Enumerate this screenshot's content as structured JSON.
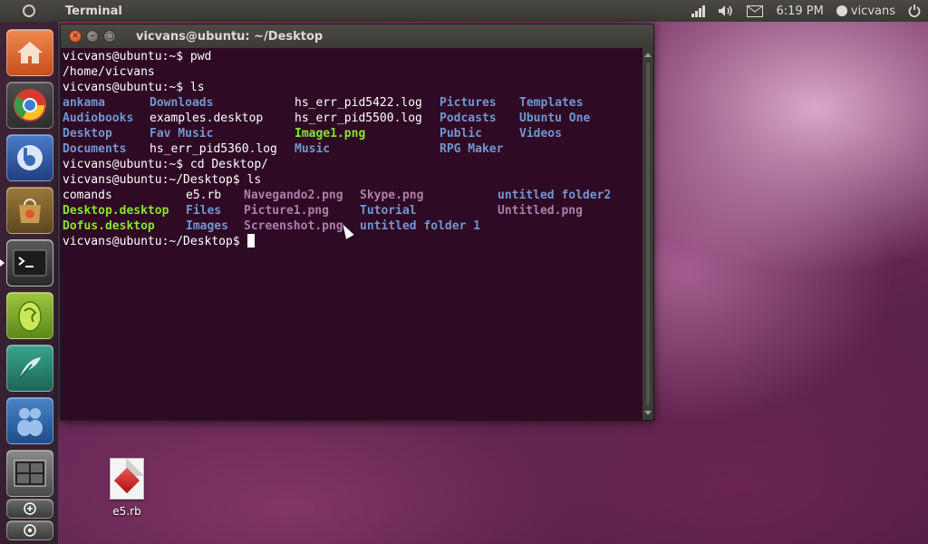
{
  "top_panel": {
    "app_title": "Terminal",
    "clock": "6:19 PM",
    "user": "vicvans",
    "icons": [
      "ubuntu-logo-icon",
      "network-signal-icon",
      "volume-icon",
      "mail-icon",
      "user-status-icon",
      "power-icon"
    ]
  },
  "launcher": {
    "items": [
      {
        "name": "home-folder",
        "icon": "home-icon",
        "color": "#e0632f",
        "active": false
      },
      {
        "name": "chromium",
        "icon": "chrome-icon",
        "color": "#3f8ad0",
        "active": false
      },
      {
        "name": "pidgin",
        "icon": "chat-icon",
        "color": "#2f5da8",
        "active": false
      },
      {
        "name": "software-center",
        "icon": "shopping-bag-icon",
        "color": "#b98a3e",
        "active": false
      },
      {
        "name": "terminal",
        "icon": "terminal-icon",
        "color": "#3a3a3a",
        "active": true
      },
      {
        "name": "dofus",
        "icon": "egg-icon",
        "color": "#7fae2e",
        "active": false
      },
      {
        "name": "rpg-maker",
        "icon": "quill-icon",
        "color": "#2a8f7a",
        "active": false
      },
      {
        "name": "ankama",
        "icon": "figures-icon",
        "color": "#2d6fb0",
        "active": false
      },
      {
        "name": "workspace-switcher",
        "icon": "workspaces-icon",
        "color": "#6a6a6a",
        "active": false
      },
      {
        "name": "applications",
        "icon": "apps-icon",
        "color": "#5a5a5a",
        "active": false
      },
      {
        "name": "files",
        "icon": "files-icon",
        "color": "#5a5a5a",
        "active": false
      }
    ]
  },
  "terminal": {
    "window_title": "vicvans@ubuntu: ~/Desktop",
    "lines": [
      {
        "type": "text",
        "text": "vicvans@ubuntu:~$ pwd"
      },
      {
        "type": "text",
        "text": "/home/vicvans"
      },
      {
        "type": "text",
        "text": "vicvans@ubuntu:~$ ls"
      },
      {
        "type": "cols",
        "cols": [
          0,
          12,
          32,
          52,
          63
        ],
        "cells": [
          {
            "text": "ankama",
            "kind": "dir"
          },
          {
            "text": "Downloads",
            "kind": "dir"
          },
          {
            "text": "hs_err_pid5422.log",
            "kind": "plain"
          },
          {
            "text": "Pictures",
            "kind": "dir"
          },
          {
            "text": "Templates",
            "kind": "dir"
          }
        ]
      },
      {
        "type": "cols",
        "cols": [
          0,
          12,
          32,
          52,
          63
        ],
        "cells": [
          {
            "text": "Audiobooks",
            "kind": "dir"
          },
          {
            "text": "examples.desktop",
            "kind": "plain"
          },
          {
            "text": "hs_err_pid5500.log",
            "kind": "plain"
          },
          {
            "text": "Podcasts",
            "kind": "dir"
          },
          {
            "text": "Ubuntu One",
            "kind": "dir"
          }
        ]
      },
      {
        "type": "cols",
        "cols": [
          0,
          12,
          32,
          52,
          63
        ],
        "cells": [
          {
            "text": "Desktop",
            "kind": "dir"
          },
          {
            "text": "Fav Music",
            "kind": "dir"
          },
          {
            "text": "Image1.png",
            "kind": "exe"
          },
          {
            "text": "Public",
            "kind": "dir"
          },
          {
            "text": "Videos",
            "kind": "dir"
          }
        ]
      },
      {
        "type": "cols",
        "cols": [
          0,
          12,
          32,
          52
        ],
        "cells": [
          {
            "text": "Documents",
            "kind": "dir"
          },
          {
            "text": "hs_err_pid5360.log",
            "kind": "plain"
          },
          {
            "text": "Music",
            "kind": "dir"
          },
          {
            "text": "RPG Maker",
            "kind": "dir"
          }
        ]
      },
      {
        "type": "text",
        "text": "vicvans@ubuntu:~$ cd Desktop/"
      },
      {
        "type": "text",
        "text": "vicvans@ubuntu:~/Desktop$ ls"
      },
      {
        "type": "cols",
        "cols": [
          0,
          17,
          25,
          41,
          60
        ],
        "cells": [
          {
            "text": "comands",
            "kind": "plain"
          },
          {
            "text": "e5.rb",
            "kind": "plain"
          },
          {
            "text": "Navegando2.png",
            "kind": "img"
          },
          {
            "text": "Skype.png",
            "kind": "img"
          },
          {
            "text": "untitled folder2",
            "kind": "dir"
          }
        ]
      },
      {
        "type": "cols",
        "cols": [
          0,
          17,
          25,
          41,
          60
        ],
        "cells": [
          {
            "text": "Desktop.desktop",
            "kind": "exe"
          },
          {
            "text": "Files",
            "kind": "dir"
          },
          {
            "text": "Picture1.png",
            "kind": "img"
          },
          {
            "text": "Tutorial",
            "kind": "dir"
          },
          {
            "text": "Untitled.png",
            "kind": "img"
          }
        ]
      },
      {
        "type": "cols",
        "cols": [
          0,
          17,
          25,
          41
        ],
        "cells": [
          {
            "text": "Dofus.desktop",
            "kind": "exe"
          },
          {
            "text": "Images",
            "kind": "dir"
          },
          {
            "text": "Screenshot.png",
            "kind": "img"
          },
          {
            "text": "untitled folder 1",
            "kind": "dir"
          }
        ]
      },
      {
        "type": "prompt",
        "text": "vicvans@ubuntu:~/Desktop$ "
      }
    ]
  },
  "desktop": {
    "icons": [
      {
        "label": "e5.rb",
        "icon": "ruby-file-icon"
      }
    ]
  }
}
